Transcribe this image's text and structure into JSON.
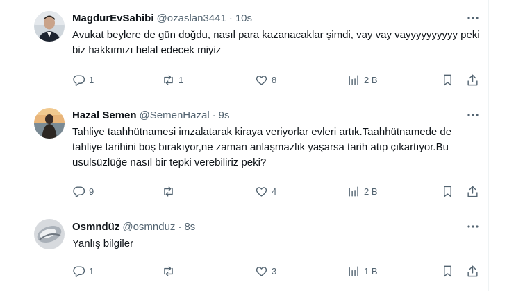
{
  "tweets": [
    {
      "name": "MagdurEvSahibi",
      "handle": "@ozaslan3441",
      "sep": "·",
      "time": "10s",
      "text": "Avukat beylere de gün doğdu, nasıl para kazanacaklar şimdi, vay vay vayyyyyyyyyy peki biz hakkımızı helal edecek miyiz",
      "stats": {
        "replies": "1",
        "reposts": "1",
        "likes": "8",
        "views": "2 B"
      }
    },
    {
      "name": "Hazal Semen",
      "handle": "@SemenHazal",
      "sep": "·",
      "time": "9s",
      "text": "Tahliye taahhütnamesi imzalatarak kiraya veriyorlar evleri artık.Taahhütnamede de tahliye tarihini boş bırakıyor,ne zaman anlaşmazlık yaşarsa tarih atıp çıkartıyor.Bu usulsüzlüğe nasıl bir tepki verebiliriz peki?",
      "stats": {
        "replies": "9",
        "reposts": "",
        "likes": "4",
        "views": "2 B"
      }
    },
    {
      "name": "Osmndüz",
      "handle": "@osmnduz",
      "sep": "·",
      "time": "8s",
      "text": "Yanlış bilgiler",
      "stats": {
        "replies": "1",
        "reposts": "",
        "likes": "3",
        "views": "1 B"
      }
    }
  ],
  "icons": [
    "reply-icon",
    "repost-icon",
    "like-icon",
    "views-icon",
    "bookmark-icon",
    "share-icon",
    "more-icon"
  ],
  "colors": {
    "text": "#0f1419",
    "secondary": "#536471",
    "border": "#eff3f4"
  }
}
